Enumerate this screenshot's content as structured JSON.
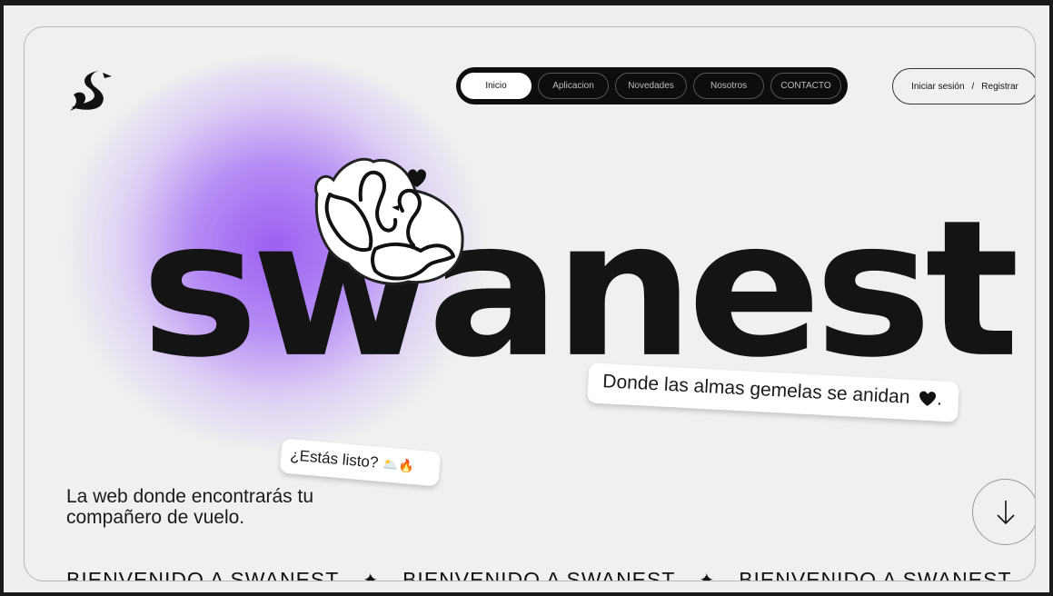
{
  "nav": {
    "items": [
      {
        "label": "Inicio",
        "active": true
      },
      {
        "label": "Aplicacion",
        "active": false
      },
      {
        "label": "Novedades",
        "active": false
      },
      {
        "label": "Nosotros",
        "active": false
      },
      {
        "label": "CONTACTO",
        "active": false
      }
    ]
  },
  "auth": {
    "login": "Iniciar sesión",
    "separator": "/",
    "register": "Registrar"
  },
  "hero": {
    "wordmark": "swanest",
    "tagline": "Donde las almas gemelas se anidan",
    "tagline_end": ".",
    "ready": "¿Estás listo?",
    "ready_emoji": "🌥️🔥",
    "intro": "La web donde encontrarás tu compañero de vuelo."
  },
  "marquee": {
    "items": [
      "BIENVENIDO A SWANEST",
      "BIENVENIDO A SWANEST",
      "BIENVENIDO A SWANEST"
    ],
    "separator": "✦"
  },
  "colors": {
    "accent": "#9b5ff0",
    "dark": "#0d0d0d",
    "background": "#f0f0f0"
  },
  "icons": {
    "logo": "swan-logo-icon",
    "sticker": "swans-heart-sticker-icon",
    "heart": "heart-icon",
    "scroll": "arrow-down-icon"
  }
}
